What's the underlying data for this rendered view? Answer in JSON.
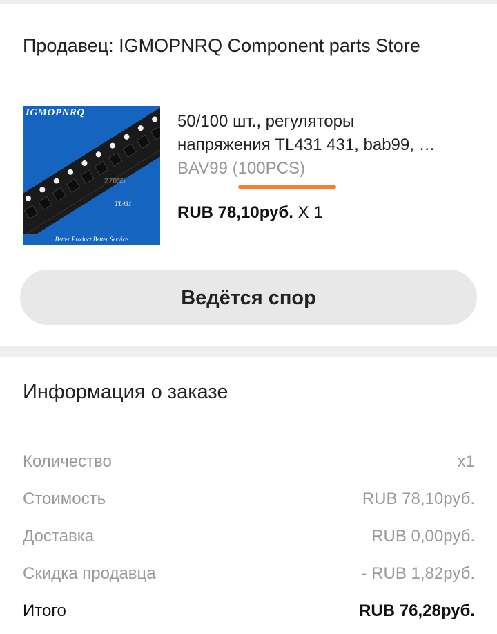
{
  "store": {
    "label": "Продавец: IGMOPNRQ Component parts Store"
  },
  "product": {
    "image": {
      "brand": "IGMOPNRQ",
      "tagline": "Better Product  Better Service",
      "part_label": "TL431",
      "watermark": "27055"
    },
    "title_line1": "50/100 шт., регуляторы",
    "title_line2": "напряжения TL431 431, bab99, …",
    "variant": "BAV99 (100PCS)",
    "price": "RUB 78,10руб.",
    "quantity": "X 1",
    "accent_color": "#f08232"
  },
  "actions": {
    "dispute_label": "Ведётся спор"
  },
  "order_info": {
    "title": "Информация о заказе",
    "rows": [
      {
        "label": "Количество",
        "value": "x1"
      },
      {
        "label": "Стоимость",
        "value": "RUB 78,10руб."
      },
      {
        "label": "Доставка",
        "value": "RUB 0,00руб."
      },
      {
        "label": "Скидка продавца",
        "value": "- RUB 1,82руб."
      },
      {
        "label": "Итого",
        "value": "RUB 76,28руб."
      }
    ]
  }
}
